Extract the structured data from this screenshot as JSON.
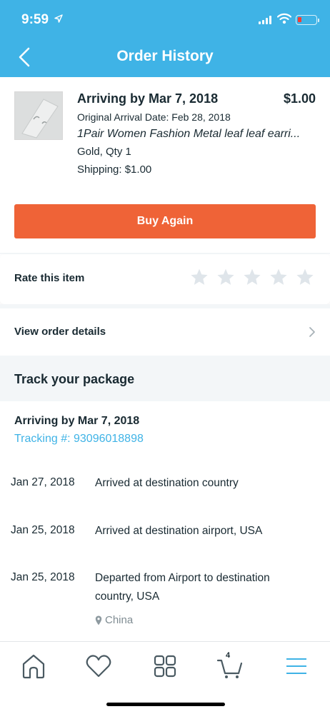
{
  "status_bar": {
    "time": "9:59"
  },
  "nav": {
    "title": "Order History"
  },
  "order": {
    "title": "Arriving by Mar 7, 2018",
    "price": "$1.00",
    "original_date": "Original Arrival Date: Feb 28, 2018",
    "product_name": "1Pair Women Fashion Metal leaf leaf earri...",
    "variant": "Gold, Qty 1",
    "shipping": "Shipping: $1.00",
    "buy_again_label": "Buy Again"
  },
  "rating": {
    "label": "Rate this item",
    "stars_total": 5,
    "stars_selected": 0
  },
  "details": {
    "label": "View order details"
  },
  "tracking": {
    "title": "Track your package",
    "arriving": "Arriving by Mar 7, 2018",
    "tracking_number": "Tracking #: 93096018898",
    "events": [
      {
        "date": "Jan 27, 2018",
        "description": "Arrived at destination country"
      },
      {
        "date": "Jan 25, 2018",
        "description": "Arrived at destination airport, USA"
      },
      {
        "date": "Jan 25, 2018",
        "description": "Departed from Airport to destination country, USA",
        "location": "China"
      }
    ]
  },
  "tabbar": {
    "items": [
      {
        "icon": "home-icon"
      },
      {
        "icon": "heart-icon"
      },
      {
        "icon": "grid-icon"
      },
      {
        "icon": "cart-icon",
        "badge": "4"
      },
      {
        "icon": "menu-icon"
      }
    ]
  },
  "colors": {
    "header": "#3fb3e6",
    "button": "#ef6337",
    "link": "#3fb3e6",
    "text": "#192a32",
    "muted": "#7f8c92",
    "band": "#f3f6f8",
    "star": "#dfe5ea"
  }
}
